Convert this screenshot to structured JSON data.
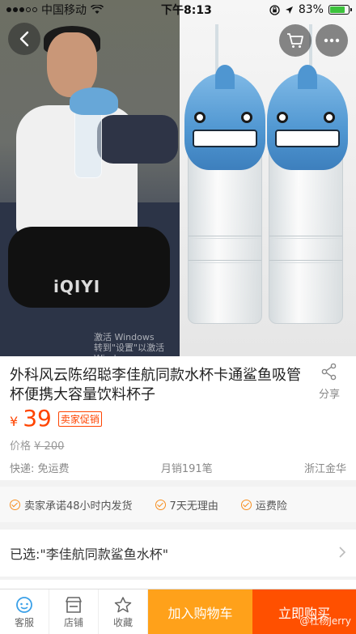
{
  "status_bar": {
    "carrier": "中国移动",
    "time": "下午8:13",
    "battery": "83%",
    "battery_level": 0.83
  },
  "hero": {
    "watermark_line1": "激活 Windows",
    "watermark_line2": "转到\"设置\"以激活 Windo",
    "logo_text": "iQIYI"
  },
  "product": {
    "title": "外科风云陈绍聪李佳航同款水杯卡通鲨鱼吸管杯便携大容量饮料杯子",
    "share_label": "分享",
    "currency": "¥",
    "price": "39",
    "promo_badge": "卖家促销",
    "original_price_label": "价格",
    "original_price": "¥ 200",
    "shipping": "快递: 免运费",
    "monthly_sales": "月销191笔",
    "location": "浙江金华"
  },
  "services": [
    "卖家承诺48小时内发货",
    "7天无理由",
    "运费险"
  ],
  "selected": {
    "text": "已选:\"李佳航同款鲨鱼水杯\""
  },
  "bottom_bar": {
    "service_label": "客服",
    "store_label": "店铺",
    "favorite_label": "收藏",
    "add_to_cart_label": "加入购物车",
    "buy_now_label": "立即购买",
    "weibo_watermark": "@杜杨Jerry"
  },
  "colors": {
    "accent": "#ff5000",
    "cart": "#ffa11a",
    "price": "#ff4400",
    "check": "#f78e1e"
  }
}
